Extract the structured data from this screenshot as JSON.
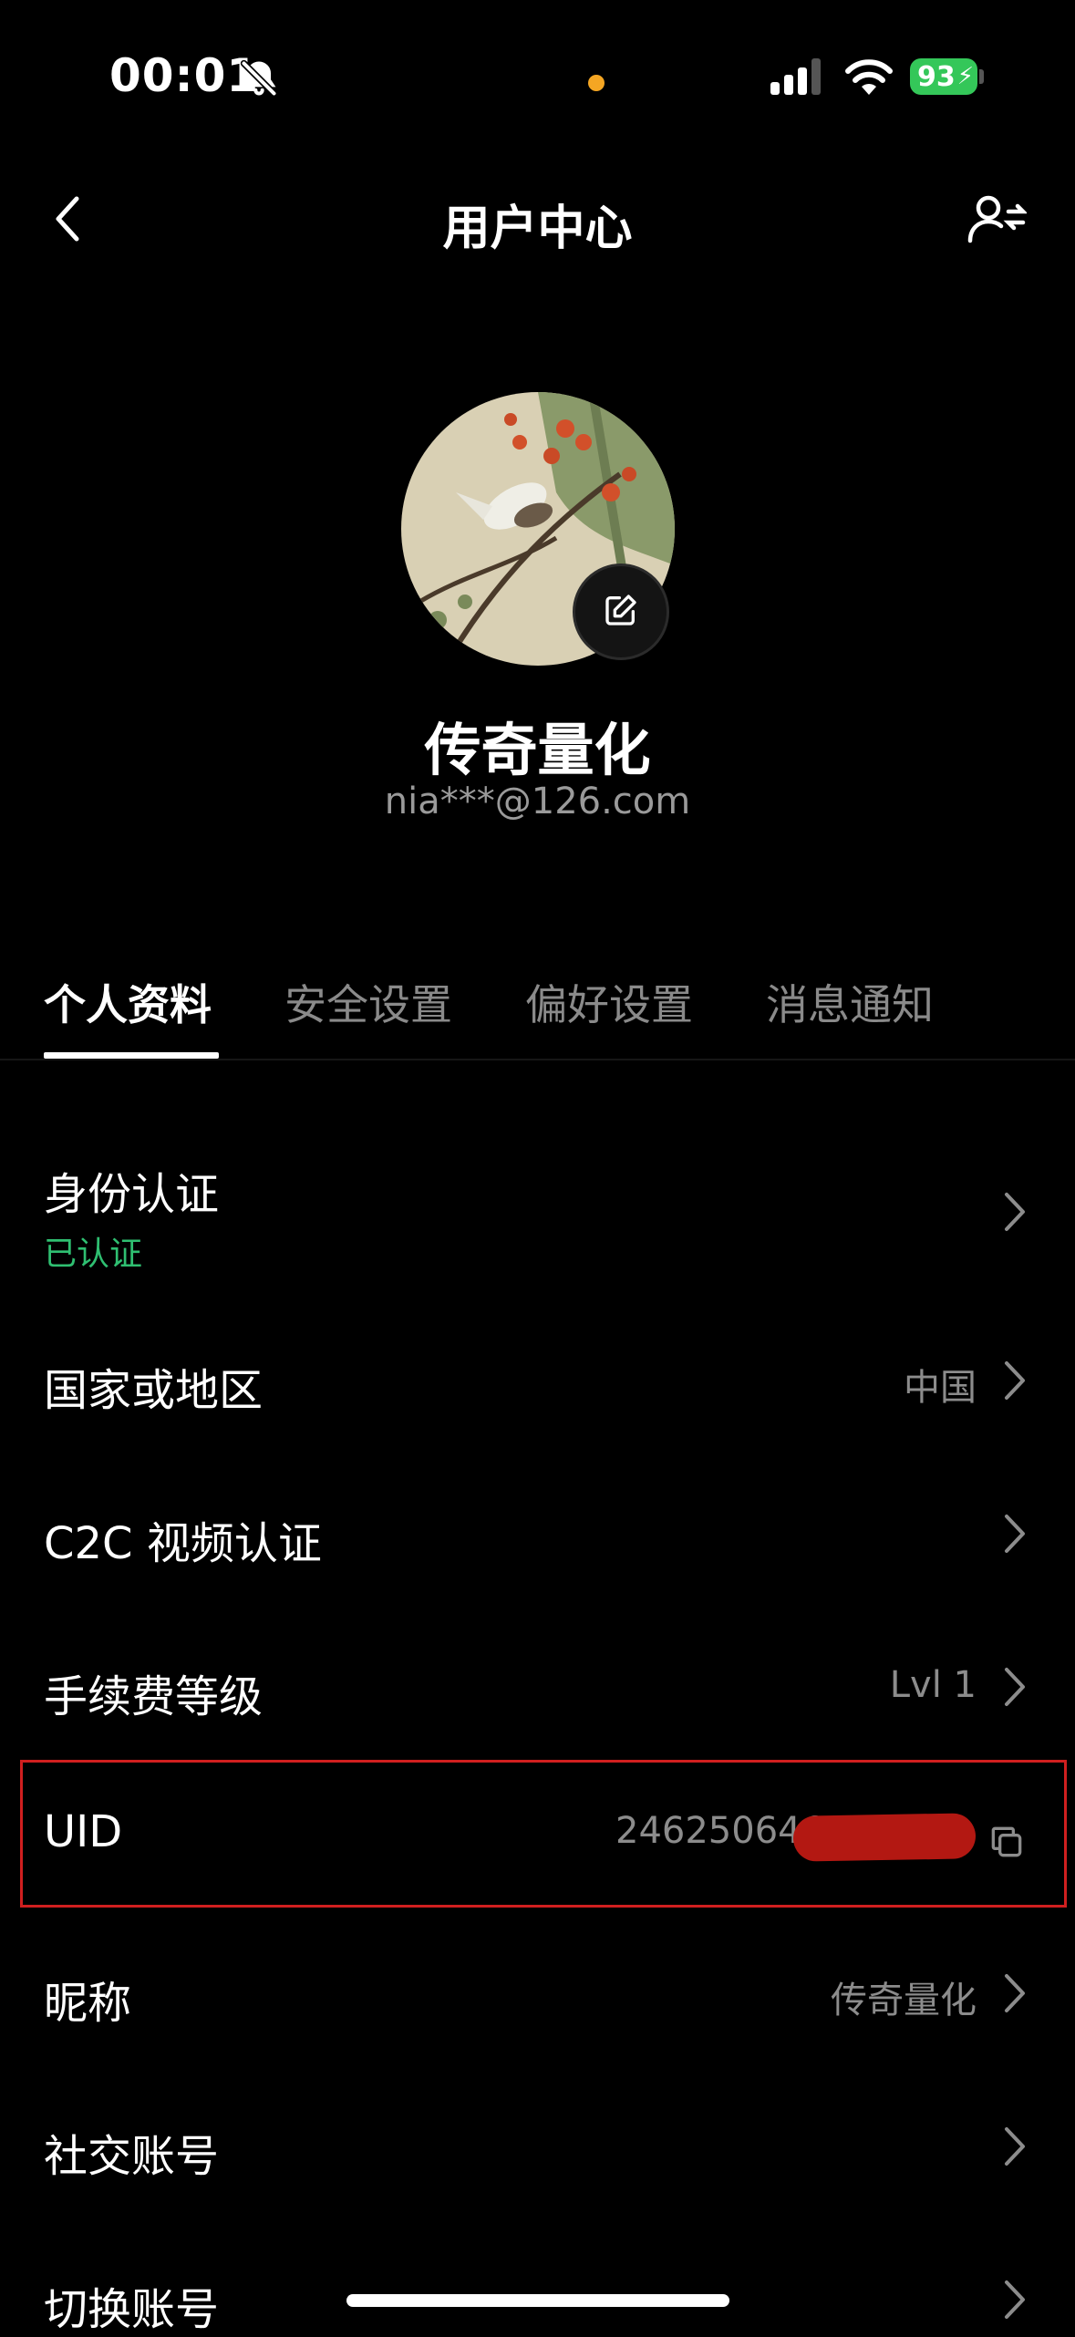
{
  "status_bar": {
    "time": "00:01",
    "battery": "93",
    "battery_color": "#34c759",
    "icons": [
      "bell-slash-icon",
      "signal-icon",
      "wifi-icon",
      "battery-icon"
    ]
  },
  "nav": {
    "title": "用户中心",
    "back_icon": "chevron-left-icon",
    "switch_account_icon": "user-switch-icon"
  },
  "profile": {
    "display_name": "传奇量化",
    "email": "nia***@126.com",
    "edit_icon": "edit-icon"
  },
  "tabs": [
    {
      "label": "个人资料",
      "active": true
    },
    {
      "label": "安全设置",
      "active": false
    },
    {
      "label": "偏好设置",
      "active": false
    },
    {
      "label": "消息通知",
      "active": false
    }
  ],
  "rows": {
    "identity": {
      "label": "身份认证",
      "sub": "已认证",
      "sub_color": "#2fbf71"
    },
    "country": {
      "label": "国家或地区",
      "value": "中国"
    },
    "c2c": {
      "label": "C2C 视频认证"
    },
    "fee": {
      "label": "手续费等级",
      "value": "Lvl 1"
    },
    "uid": {
      "label": "UID",
      "value": "24625064€",
      "highlight_color": "#d01f1f"
    },
    "nickname": {
      "label": "昵称",
      "value": "传奇量化"
    },
    "social": {
      "label": "社交账号"
    },
    "switch": {
      "label": "切换账号"
    }
  }
}
